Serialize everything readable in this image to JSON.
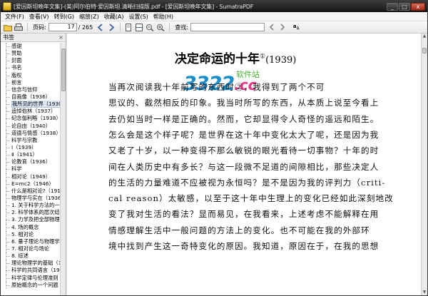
{
  "window": {
    "title": "[爱因斯坦晚年文集]-(美)阿尔伯特·爱因斯坦.清晰扫描版.pdf - [爱因斯坦晚年文集] - SumatraPDF",
    "minimize": "_",
    "maximize": "□",
    "close": "x"
  },
  "menu": [
    "文件(F)",
    "查看(V)",
    "转到(G)",
    "缩放(Z)",
    "收藏(A)",
    "设置(S)",
    "帮助(H)"
  ],
  "toolbar": {
    "page_label": "页码:",
    "page_value": "17",
    "page_total": "/ 265",
    "find_label": "查找:",
    "case_label": "a"
  },
  "sidebar": {
    "title": "书签",
    "close": "×",
    "items": [
      "感谢",
      "赞助",
      "封面",
      "书名",
      "版权",
      "前言",
      "信念与信仰",
      "自画像（1936）",
      "我所见的世界（1930）",
      "追悼伯林（1937）",
      "纪念伽利略（1938）",
      "论自由（1940）",
      "道德与情感（1938）",
      "科学与宗教",
      "Ⅰ（1939）",
      "Ⅱ（1941）",
      "论教育（1936）",
      "科学",
      "相对论（1949）",
      "E=mc2（1946）",
      "什么是相对论?（1919）",
      "物理学与实在（1936）",
      "1. 关于科学方法的一般考察",
      "2. 科学体系的层次结构",
      "3. 力学及把全部物理学",
      "4. 场的概念",
      "5. 相对论",
      "6. 量子理论与物理学基础",
      "7. 相对论与场论",
      "8. 综述",
      "理论物理学的基础（1940）",
      "科学的共同语言（1941）",
      "科学定律与伦理准则（1950）",
      "原始概念的一个问题"
    ],
    "selected_index": 8
  },
  "document": {
    "chapter_title": "决定命运的十年",
    "title_note": "①",
    "title_year": "(1939)",
    "watermark_main": "3322",
    "watermark_cc": ".cc",
    "watermark_site": "软件站",
    "lines": [
      "当再次阅读我十年前写的东西时②，我得到了两个不可",
      "思议的、截然相反的印象。我当时所写的东西，从本质上说至今看上",
      "去仍如当时一样是正确的。然而，它却显得令人奇怪的遥远和陌生。",
      "怎么会是这个样子呢？是世界在这十年中变化太大了呢，还是因为我",
      "又老了十岁，以一种变得不那么敏锐的眼光看待一切事物？十年的时",
      "间在人类历史中有多长？与这一段微不足道的间隙相比，那些决定人",
      "的生活的力量难道不应被视为永恒吗？是不是因为我的评判力（criti-",
      "cal reason）太敏感，以至于这十年中生理上的变化已经如此深刻地改",
      "变了我对生活的看法？显而易见，在我看来，上述考虑不能解释在用",
      "情感理解生活中一般问题的方法上的变化。也不可能在我的外部环",
      "境中找到产生这一奇特变化的原因。我知道，原因在于，在我的思想"
    ]
  }
}
